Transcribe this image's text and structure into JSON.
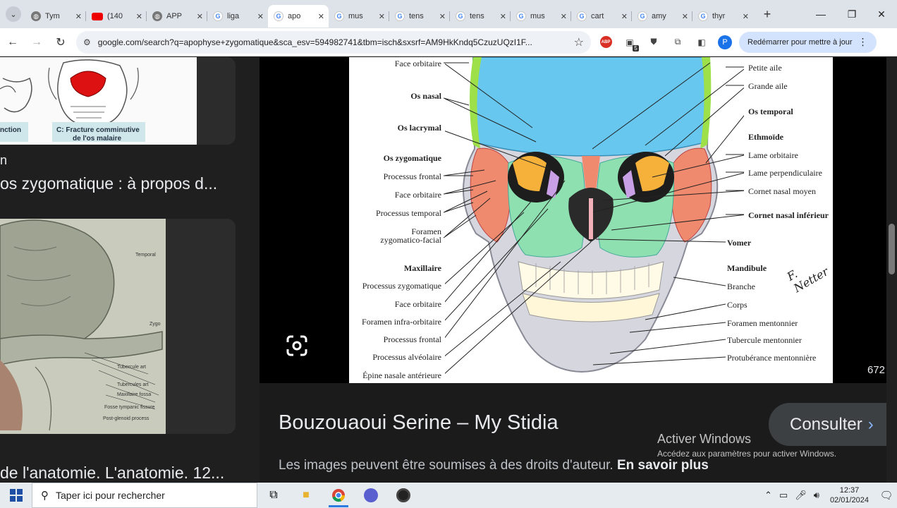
{
  "browser": {
    "tabs": [
      {
        "label": "Tym",
        "icon": "globe-icon"
      },
      {
        "label": "(140",
        "icon": "youtube-icon"
      },
      {
        "label": "APP",
        "icon": "globe-icon"
      },
      {
        "label": "liga",
        "icon": "google-icon"
      },
      {
        "label": "apo",
        "icon": "google-icon",
        "active": true
      },
      {
        "label": "mus",
        "icon": "google-icon"
      },
      {
        "label": "tens",
        "icon": "google-icon"
      },
      {
        "label": "tens",
        "icon": "google-icon"
      },
      {
        "label": "mus",
        "icon": "google-icon"
      },
      {
        "label": "cart",
        "icon": "google-icon"
      },
      {
        "label": "amy",
        "icon": "google-icon"
      },
      {
        "label": "thyr",
        "icon": "google-icon"
      }
    ],
    "url": "google.com/search?q=apophyse+zygomatique&sca_esv=594982741&tbm=isch&sxsrf=AM9HkKndq5CzuzUQzI1F...",
    "restart_label": "Redémarrer pour mettre à jour",
    "profile_initial": "P",
    "abp_label": "ABP",
    "ext_badge": "5"
  },
  "left": {
    "thumb1_caption_a": "nction",
    "thumb1_caption_b": "C: Fracture comminutive",
    "thumb1_caption_c": "de l'os malaire",
    "item1_source": "n",
    "item1_title": "os zygomatique : à propos d...",
    "thumb2_labels": [
      "Temporal",
      "Zygo",
      "Tubercule art",
      "Tubercules art",
      "Maxillaire fossa",
      "Fosse tympanic fissure",
      "Post-glenoid process"
    ],
    "item2_title": "de l'anatomie. L'anatomie. 12..."
  },
  "preview": {
    "skull_labels_left": [
      "Face orbitaire",
      "Os nasal",
      "Os lacrymal",
      "Os zygomatique",
      "Processus frontal",
      "Face orbitaire",
      "Processus temporal",
      "Foramen",
      "zygomatico-facial",
      "Maxillaire",
      "Processus zygomatique",
      "Face orbitaire",
      "Foramen infra-orbitaire",
      "Processus frontal",
      "Processus alvéolaire",
      "Épine nasale antérieure"
    ],
    "skull_labels_right": [
      "Petite aile",
      "Grande aile",
      "Os temporal",
      "Ethmoïde",
      "Lame orbitaire",
      "Lame perpendiculaire",
      "Cornet nasal moyen",
      "Cornet nasal inférieur",
      "Vomer",
      "Mandibule",
      "Branche",
      "Corps",
      "Foramen mentonnier",
      "Tubercule mentonnier",
      "Protubérance mentonnière"
    ],
    "signature": "F. Netter",
    "counter": "672",
    "source_title": "Bouzouaoui Serine – My Stidia",
    "copyright_text": "Les images peuvent être soumises à des droits d'auteur.",
    "learn_more": "En savoir plus",
    "consult_label": "Consulter",
    "colors": {
      "frontal": "#67c7ee",
      "maxilla": "#8fe0b0",
      "zygomatic": "#f08a6e",
      "mandible": "#c8c8d4",
      "sphenoid": "#f6b13a"
    }
  },
  "watermark": {
    "title": "Activer Windows",
    "subtitle": "Accédez aux paramètres pour activer Windows."
  },
  "taskbar": {
    "search_placeholder": "Taper ici pour rechercher",
    "time": "12:37",
    "date": "02/01/2024"
  }
}
